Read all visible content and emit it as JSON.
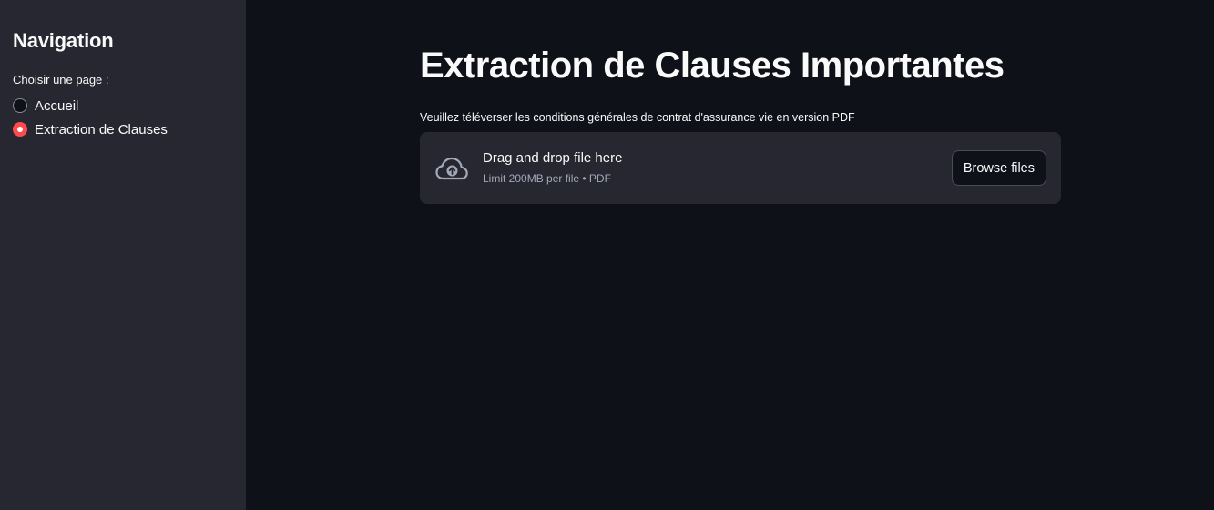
{
  "sidebar": {
    "title": "Navigation",
    "radio_label": "Choisir une page :",
    "options": [
      {
        "label": "Accueil",
        "selected": false
      },
      {
        "label": "Extraction de Clauses",
        "selected": true
      }
    ]
  },
  "main": {
    "title": "Extraction de Clauses Importantes",
    "uploader": {
      "label": "Veuillez téléverser les conditions générales de contrat d'assurance vie en version PDF",
      "drop_text": "Drag and drop file here",
      "limit_text": "Limit 200MB per file • PDF",
      "browse_label": "Browse files",
      "icon": "cloud-upload-icon"
    }
  },
  "colors": {
    "background": "#0e1117",
    "sidebar": "#262730",
    "accent": "#ff4b4b",
    "text": "#fafafa",
    "muted_text": "#a3a8b8"
  }
}
